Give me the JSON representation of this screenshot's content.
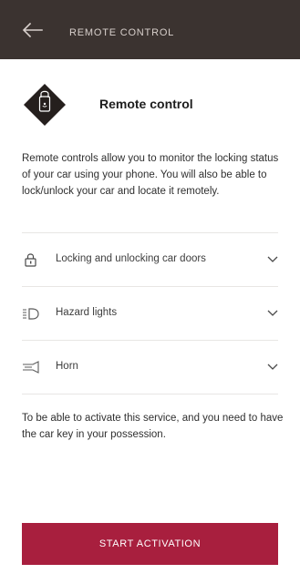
{
  "topbar": {
    "title": "REMOTE CONTROL",
    "back_icon": "arrow-left-icon"
  },
  "hero": {
    "title": "Remote control",
    "icon": "lock-phone-icon"
  },
  "description": "Remote controls allow you to monitor the locking status of your car using your phone. You will also be able to lock/unlock your car and locate it remotely.",
  "features": [
    {
      "label": "Locking and unlocking car doors",
      "icon": "lock-icon"
    },
    {
      "label": "Hazard lights",
      "icon": "hazard-lights-icon"
    },
    {
      "label": "Horn",
      "icon": "horn-icon"
    }
  ],
  "notice": "To be able to  activate this service, and you need to have the car key in your possession.",
  "cta": {
    "label": "START ACTIVATION"
  },
  "colors": {
    "topbar": "#3b3330",
    "accent": "#a81f3e",
    "text": "#2a2a2a"
  }
}
